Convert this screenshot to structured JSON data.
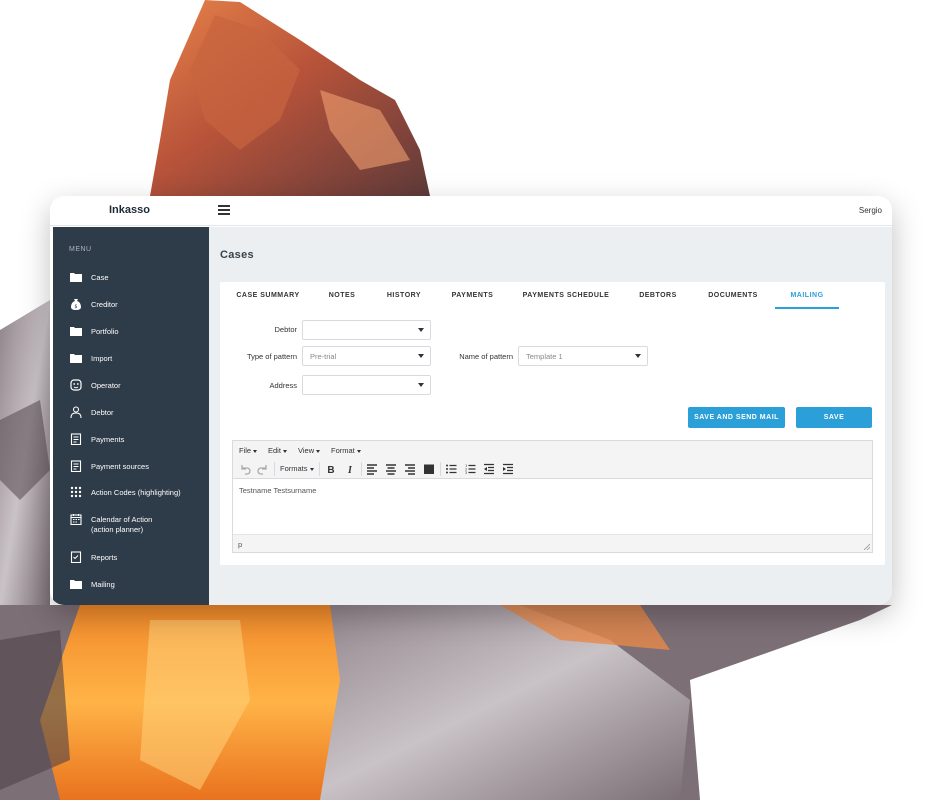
{
  "app": {
    "brand": "Inkasso",
    "user": "Sergio"
  },
  "sidebar": {
    "title": "MENU",
    "items": [
      {
        "label": "Case",
        "icon": "folder-icon"
      },
      {
        "label": "Creditor",
        "icon": "money-bag-icon"
      },
      {
        "label": "Portfolio",
        "icon": "folder-icon"
      },
      {
        "label": "Import",
        "icon": "folder-icon"
      },
      {
        "label": "Operator",
        "icon": "face-icon"
      },
      {
        "label": "Debtor",
        "icon": "person-icon"
      },
      {
        "label": "Payments",
        "icon": "clipboard-icon"
      },
      {
        "label": "Payment sources",
        "icon": "clipboard-icon"
      },
      {
        "label": "Action Codes (highlighting)",
        "icon": "grid-icon"
      },
      {
        "label": "Calendar of Action",
        "label2": "(action planner)",
        "icon": "calendar-icon"
      },
      {
        "label": "Reports",
        "icon": "report-icon"
      },
      {
        "label": "Mailing",
        "icon": "folder-icon"
      }
    ]
  },
  "page": {
    "title": "Cases"
  },
  "tabs": [
    {
      "label": "CASE SUMMARY",
      "active": false
    },
    {
      "label": "NOTES",
      "active": false
    },
    {
      "label": "HISTORY",
      "active": false
    },
    {
      "label": "PAYMENTS",
      "active": false
    },
    {
      "label": "PAYMENTS SCHEDULE",
      "active": false
    },
    {
      "label": "DEBTORS",
      "active": false
    },
    {
      "label": "DOCUMENTS",
      "active": false
    },
    {
      "label": "MAILING",
      "active": true
    }
  ],
  "form": {
    "debtor": {
      "label": "Debtor",
      "value": ""
    },
    "type_of_pattern": {
      "label": "Type of pattern",
      "value": "Pre-trial"
    },
    "name_of_pattern": {
      "label": "Name of pattern",
      "value": "Template 1"
    },
    "address": {
      "label": "Address",
      "value": ""
    }
  },
  "buttons": {
    "save_and_send": "SAVE AND SEND MAIL",
    "save": "SAVE"
  },
  "editor": {
    "menus": [
      "File",
      "Edit",
      "View",
      "Format"
    ],
    "formats_label": "Formats",
    "content": "Testname Testsurname",
    "path": "p"
  },
  "colors": {
    "accent": "#2a9fd8",
    "sidebar": "#2e3b48",
    "main_bg": "#eceff1"
  }
}
